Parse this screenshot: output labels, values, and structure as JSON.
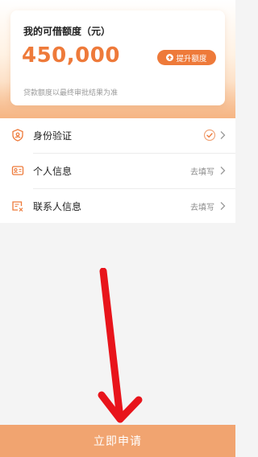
{
  "limit_card": {
    "title": "我的可借额度（元）",
    "amount": "450,000",
    "raise_button": "提升额度",
    "note": "贷款额度以最终审批结果为准"
  },
  "verification_list": [
    {
      "label": "身份验证",
      "status": "",
      "icon": "id-badge-icon",
      "completed": true
    },
    {
      "label": "个人信息",
      "status": "去填写",
      "icon": "id-card-icon",
      "completed": false
    },
    {
      "label": "联系人信息",
      "status": "去填写",
      "icon": "contact-card-icon",
      "completed": false
    }
  ],
  "footer": {
    "apply_button": "立即申请"
  },
  "colors": {
    "accent": "#ee7a3a",
    "button_disabled": "#f1a470",
    "annotation_arrow": "#e8141b"
  }
}
